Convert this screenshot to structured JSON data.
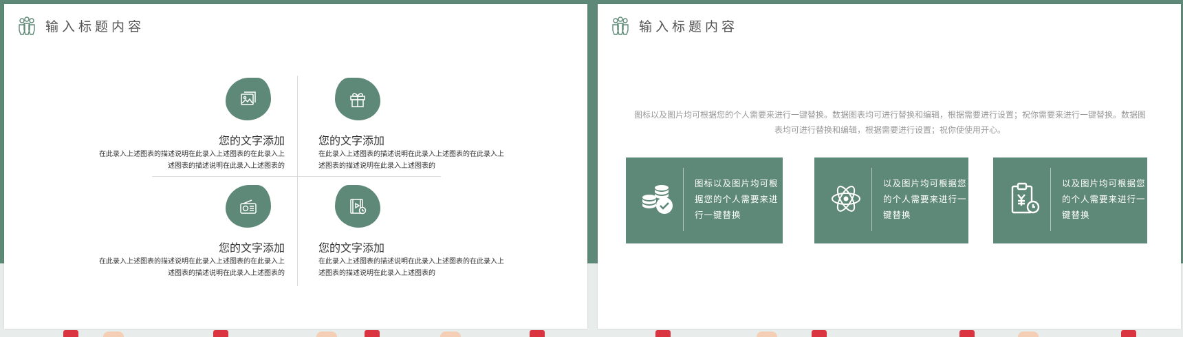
{
  "colors": {
    "accent": "#5e8877",
    "text": "#333333",
    "muted": "#999999"
  },
  "slide1": {
    "title": "输入标题内容",
    "header_icon": "people-icon",
    "items": [
      {
        "icon": "picture-icon",
        "title": "您的文字添加",
        "desc": "在此录入上述图表的描述说明在此录入上述图表的在此录入上述图表的描述说明在此录入上述图表的"
      },
      {
        "icon": "gift-icon",
        "title": "您的文字添加",
        "desc": "在此录入上述图表的描述说明在此录入上述图表的在此录入上述图表的描述说明在此录入上述图表的"
      },
      {
        "icon": "radio-icon",
        "title": "您的文字添加",
        "desc": "在此录入上述图表的描述说明在此录入上述图表的在此录入上述图表的描述说明在此录入上述图表的"
      },
      {
        "icon": "video-file-icon",
        "title": "您的文字添加",
        "desc": "在此录入上述图表的描述说明在此录入上述图表的在此录入上述图表的描述说明在此录入上述图表的"
      }
    ]
  },
  "slide2": {
    "title": "输入标题内容",
    "header_icon": "people-icon",
    "intro": "图标以及图片均可根据您的个人需要来进行一键替换。数据图表均可进行替换和编辑，根据需要进行设置；祝你需要来进行一键替换。数据图表均可进行替换和编辑，根据需要进行设置；祝你使使用开心。",
    "cards": [
      {
        "icon": "coins-check-icon",
        "text": "图标以及图片均可根据您的个人需要来进行一键替换"
      },
      {
        "icon": "atom-icon",
        "text": "以及图片均可根据您的个人需要来进行一键替换"
      },
      {
        "icon": "clipboard-yen-icon",
        "text": "以及图片均可根据您的个人需要来进行一键替换"
      }
    ]
  }
}
